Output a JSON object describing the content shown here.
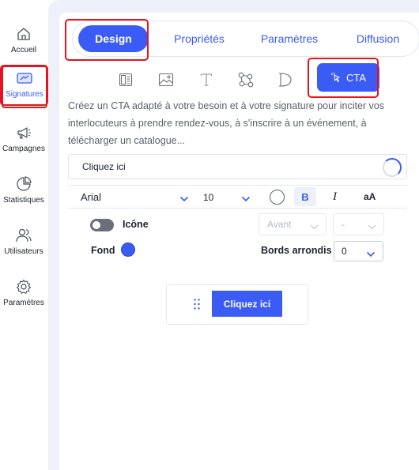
{
  "sidebar": {
    "items": [
      {
        "label": "Accueil",
        "icon": "home-icon",
        "active": false
      },
      {
        "label": "Signatures",
        "icon": "signature-card-icon",
        "active": true
      },
      {
        "label": "Campagnes",
        "icon": "megaphone-icon",
        "active": false
      },
      {
        "label": "Statistiques",
        "icon": "pie-chart-icon",
        "active": false
      },
      {
        "label": "Utilisateurs",
        "icon": "users-icon",
        "active": false
      },
      {
        "label": "Paramètres",
        "icon": "gear-icon",
        "active": false
      }
    ]
  },
  "tabs": [
    {
      "label": "Design",
      "active": true
    },
    {
      "label": "Propriétés",
      "active": false
    },
    {
      "label": "Paramètres",
      "active": false
    },
    {
      "label": "Diffusion",
      "active": false
    }
  ],
  "element_types": {
    "icons": [
      "layout-icon",
      "image-icon",
      "text-icon",
      "social-network-icon",
      "signature-d-icon"
    ],
    "cta_label": "CTA",
    "cta_icon": "cursor-click-icon"
  },
  "description": "Créez un CTA adapté à votre besoin et à votre signature pour inciter vos interlocuteurs à prendre rendez-vous, à s'inscrire à un événement, à télécharger un catalogue...",
  "cta_text_input": {
    "value": "Cliquez ici"
  },
  "format": {
    "font": "Arial",
    "size": "10",
    "bold": "B",
    "italic": "I",
    "case": "aA"
  },
  "options": {
    "icon_label": "Icône",
    "icon_enabled": false,
    "position_value": "Avant",
    "icon_choice_value": "-",
    "background_label": "Fond",
    "background_color": "#3b5bf5",
    "rounded_label": "Bords arrondis",
    "rounded_value": "0"
  },
  "preview": {
    "button_label": "Cliquez ici"
  },
  "colors": {
    "accent": "#3b5bf5",
    "highlight": "#e5131f"
  }
}
